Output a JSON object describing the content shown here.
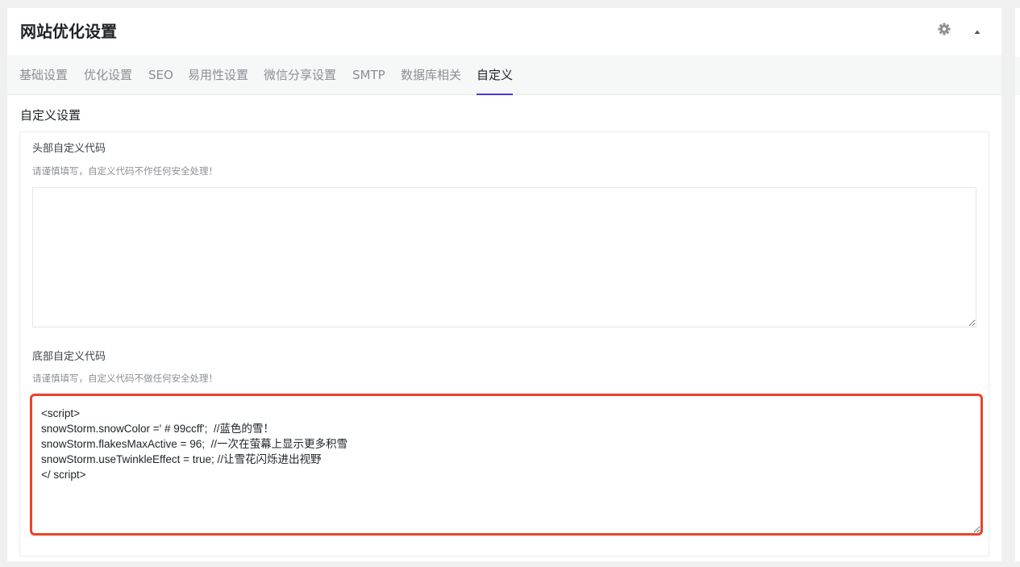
{
  "header": {
    "title": "网站优化设置",
    "settings_icon": "gear-icon",
    "toggle_icon": "triangle-up-icon"
  },
  "tabs": [
    {
      "label": "基础设置",
      "active": false
    },
    {
      "label": "优化设置",
      "active": false
    },
    {
      "label": "SEO",
      "active": false
    },
    {
      "label": "易用性设置",
      "active": false
    },
    {
      "label": "微信分享设置",
      "active": false
    },
    {
      "label": "SMTP",
      "active": false
    },
    {
      "label": "数据库相关",
      "active": false
    },
    {
      "label": "自定义",
      "active": true
    }
  ],
  "section": {
    "title": "自定义设置"
  },
  "fields": {
    "head_code": {
      "label": "头部自定义代码",
      "hint": "请谨慎填写，自定义代码不作任何安全处理！",
      "value": ""
    },
    "footer_code": {
      "label": "底部自定义代码",
      "hint": "请谨慎填写，自定义代码不做任何安全处理！",
      "value": "<script>\nsnowStorm.snowColor =' # 99ccff';  //蓝色的雪！\nsnowStorm.flakesMaxActive = 96;  //一次在萤幕上显示更多积雪\nsnowStorm.useTwinkleEffect = true; //让雪花闪烁进出视野\n</ script>"
    }
  },
  "colors": {
    "accent": "#4f35c8",
    "highlight_border": "#e8442a"
  }
}
